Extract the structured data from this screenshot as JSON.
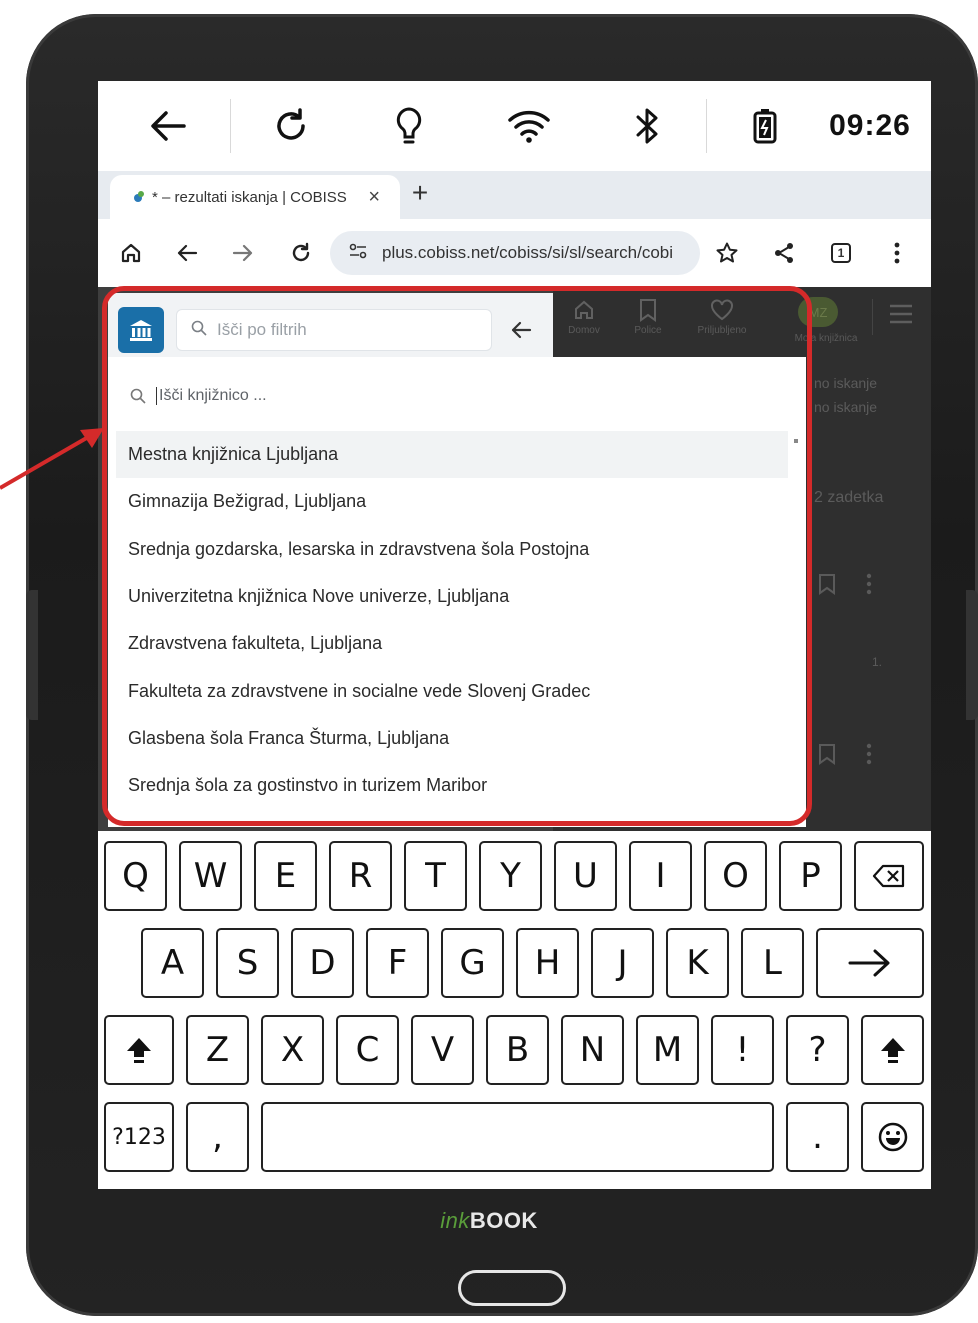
{
  "statusbar": {
    "time": "09:26",
    "icons": [
      "back-arrow-icon",
      "refresh-icon",
      "lightbulb-icon",
      "wifi-icon",
      "bluetooth-icon",
      "battery-icon"
    ]
  },
  "browser": {
    "tab_title": "* – rezultati iskanja | COBISS",
    "tab_close": "×",
    "new_tab": "+",
    "url": "plus.cobiss.net/cobiss/si/sl/search/cobi",
    "tab_count": "1"
  },
  "page": {
    "filter_placeholder": "Išči po filtrih",
    "nav": [
      "Domov",
      "Police",
      "Priljubljeno",
      "Moja knjižnica"
    ],
    "avatar": "MZ",
    "bg_texts": [
      "no iskanje",
      "no iskanje",
      "2 zadetka",
      "1."
    ]
  },
  "library_dropdown": {
    "search_placeholder": "Išči knjižnico ...",
    "items": [
      "Mestna knjižnica Ljubljana",
      "Gimnazija Bežigrad, Ljubljana",
      "Srednja gozdarska, lesarska in zdravstvena šola Postojna",
      "Univerzitetna knjižnica Nove univerze, Ljubljana",
      "Zdravstvena fakulteta, Ljubljana",
      "Fakulteta za zdravstvene in socialne vede Slovenj Gradec",
      "Glasbena šola Franca Šturma, Ljubljana",
      "Srednja šola za gostinstvo in turizem Maribor"
    ]
  },
  "keyboard": {
    "row1": [
      "Q",
      "W",
      "E",
      "R",
      "T",
      "Y",
      "U",
      "I",
      "O",
      "P"
    ],
    "row2": [
      "A",
      "S",
      "D",
      "F",
      "G",
      "H",
      "J",
      "K",
      "L"
    ],
    "row3": [
      "Z",
      "X",
      "C",
      "V",
      "B",
      "N",
      "M",
      "!",
      "?"
    ],
    "numbers_key": "?123",
    "comma_key": ",",
    "period_key": "."
  },
  "device": {
    "brand_ink": "ink",
    "brand_book": "BOOK"
  },
  "colors": {
    "highlight": "#d42a2a",
    "accent": "#1a6fa8",
    "brand_green": "#5a9e3a"
  }
}
